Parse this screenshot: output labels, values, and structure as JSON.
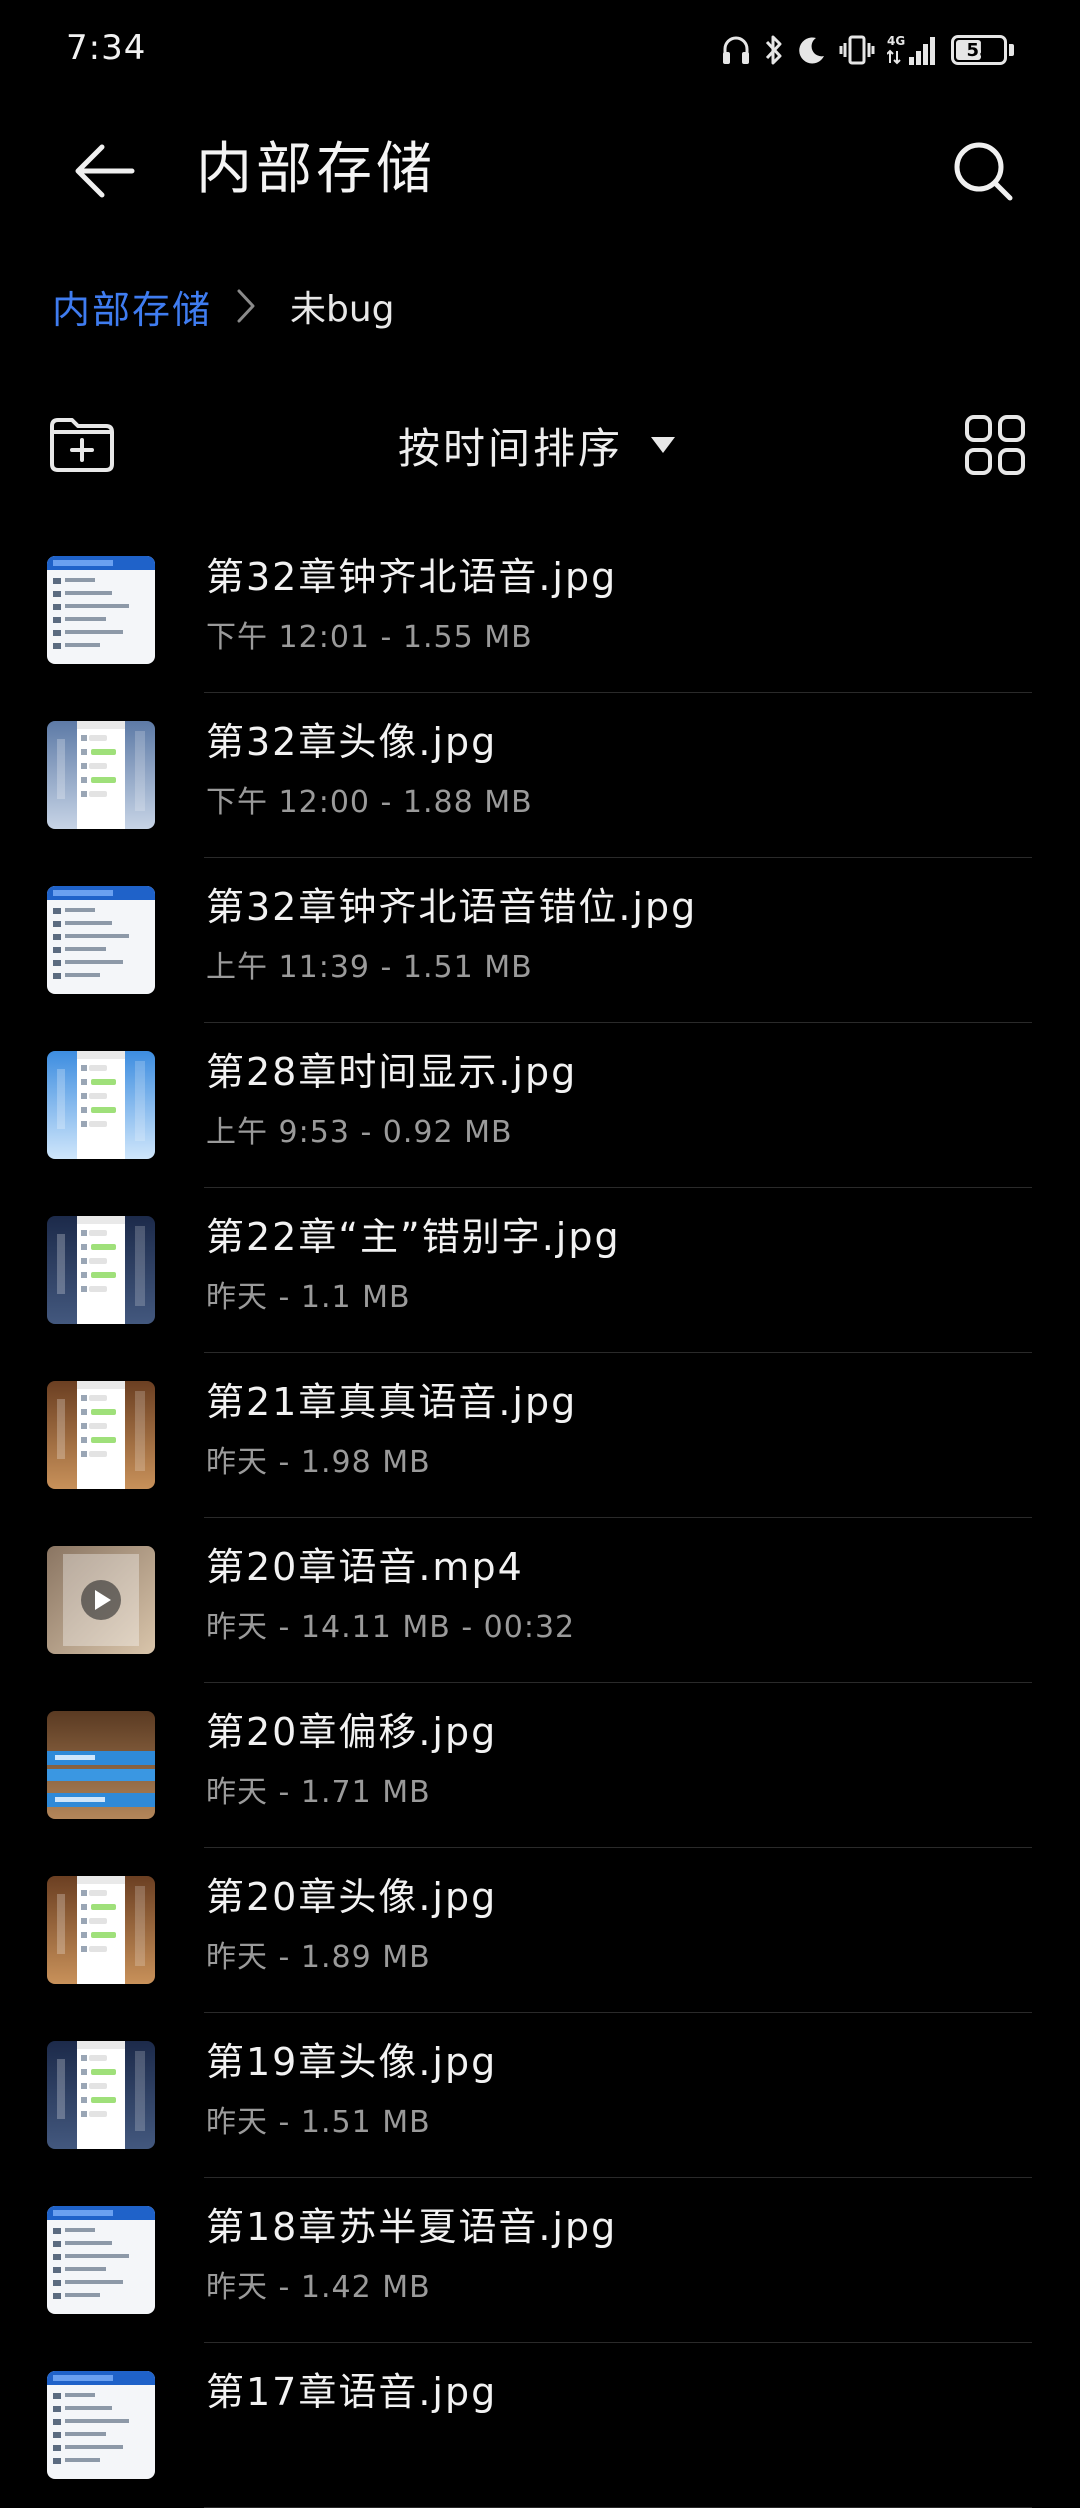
{
  "status_bar": {
    "time": "7:34",
    "network": "4G",
    "battery": "55",
    "battery_level": 0.55
  },
  "header": {
    "title": "内部存储",
    "back_icon": "arrow-left-icon",
    "search_icon": "search-icon"
  },
  "breadcrumb": {
    "root": "内部存储",
    "current": "未bug"
  },
  "toolbar": {
    "sort_label": "按时间排序",
    "new_folder_icon": "folder-add-icon",
    "grid_icon": "grid-view-icon"
  },
  "files": [
    {
      "name": "第32章钟齐北语音.jpg",
      "meta": "下午 12:01 - 1.55 MB",
      "thumb": "doc"
    },
    {
      "name": "第32章头像.jpg",
      "meta": "下午 12:00 - 1.88 MB",
      "thumb": "phone-city"
    },
    {
      "name": "第32章钟齐北语音错位.jpg",
      "meta": "上午 11:39 - 1.51 MB",
      "thumb": "doc"
    },
    {
      "name": "第28章时间显示.jpg",
      "meta": "上午 9:53 - 0.92 MB",
      "thumb": "phone-sky"
    },
    {
      "name": "第22章“主”错别字.jpg",
      "meta": "昨天 - 1.1 MB",
      "thumb": "phone-night"
    },
    {
      "name": "第21章真真语音.jpg",
      "meta": "昨天 - 1.98 MB",
      "thumb": "phone-cafe"
    },
    {
      "name": "第20章语音.mp4",
      "meta": "昨天 - 14.11 MB - 00:32",
      "thumb": "video"
    },
    {
      "name": "第20章偏移.jpg",
      "meta": "昨天 - 1.71 MB",
      "thumb": "bars-cafe"
    },
    {
      "name": "第20章头像.jpg",
      "meta": "昨天 - 1.89 MB",
      "thumb": "phone-cafe"
    },
    {
      "name": "第19章头像.jpg",
      "meta": "昨天 - 1.51 MB",
      "thumb": "phone-night"
    },
    {
      "name": "第18章苏半夏语音.jpg",
      "meta": "昨天 - 1.42 MB",
      "thumb": "doc"
    },
    {
      "name": "第17章语音.jpg",
      "meta": "",
      "thumb": "doc"
    }
  ],
  "colors": {
    "background": "#000000",
    "accent": "#3f7cf0",
    "text_primary": "#f2f2f2",
    "text_secondary": "#9a9a9a",
    "divider": "#2a2a2a"
  }
}
